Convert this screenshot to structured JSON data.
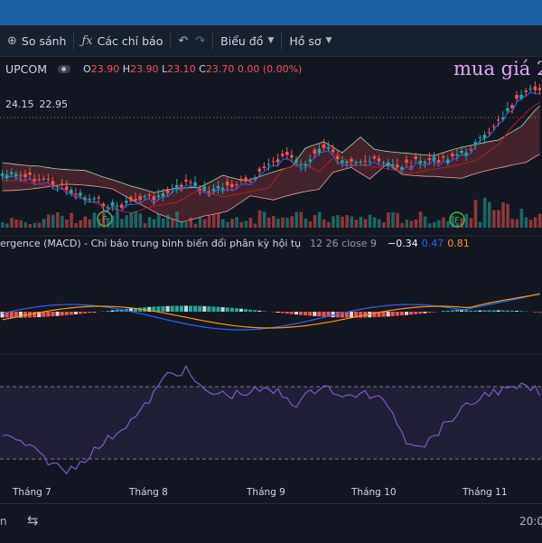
{
  "toolbar": {
    "compare_label": "So sánh",
    "indicators_label": "Các chỉ báo",
    "chart_label": "Biểu đồ",
    "profile_label": "Hồ sơ"
  },
  "legend": {
    "exchange": "UPCOM",
    "o_label": "O",
    "o_value": "23.90",
    "h_label": "H",
    "h_value": "23.90",
    "l_label": "L",
    "l_value": "23.10",
    "c_label": "C",
    "c_value": "23.70",
    "change": "0.00 (0.00%)"
  },
  "ichimoku": {
    "v1": "24.15",
    "v2": "22.95"
  },
  "annotation": "mua giá 2",
  "macd": {
    "title": "ergence (MACD) - Chỉ báo trung bình biến đổi phân kỳ hội tụ",
    "params": "12 26 close 9",
    "hist": "−0.34",
    "macd": "0.47",
    "signal": "0.81"
  },
  "months": [
    "Tháng 7",
    "Tháng 8",
    "Tháng 9",
    "Tháng 10",
    "Tháng 11"
  ],
  "event_marker": "F",
  "time_label": "20:0",
  "bottom_left": "n",
  "colors": {
    "up": "#26a69a",
    "down": "#ef5350",
    "macd_line": "#2962ff",
    "signal_line": "#ff9800",
    "rsi": "#7e57c2",
    "annotation": "#e0a6f2"
  }
}
